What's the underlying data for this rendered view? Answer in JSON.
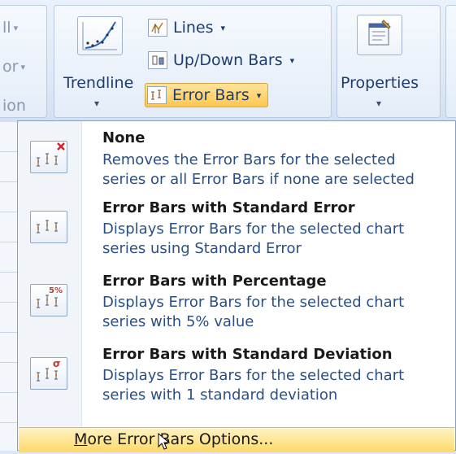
{
  "ribbon": {
    "left_fragments": [
      "ll",
      "or",
      "ion"
    ],
    "trendline": {
      "label": "Trendline"
    },
    "lines": {
      "label": "Lines"
    },
    "updown": {
      "label": "Up/Down Bars"
    },
    "errorbars": {
      "label": "Error Bars"
    },
    "properties": {
      "label": "Properties"
    }
  },
  "menu": {
    "items": [
      {
        "title": "None",
        "desc": [
          "Removes the Error Bars for the selected",
          "series or all Error Bars if none are selected"
        ],
        "icon": "error-bars-none-icon"
      },
      {
        "title": "Error Bars with Standard Error",
        "desc": [
          "Displays Error Bars for the selected chart",
          "series using Standard Error"
        ],
        "icon": "error-bars-standard-error-icon"
      },
      {
        "title": "Error Bars with Percentage",
        "desc": [
          "Displays Error Bars for the selected chart",
          "series with 5% value"
        ],
        "icon": "error-bars-percentage-icon",
        "badge": "5%"
      },
      {
        "title": "Error Bars with Standard Deviation",
        "desc": [
          "Displays Error Bars for the selected chart",
          "series with 1 standard deviation"
        ],
        "icon": "error-bars-standard-deviation-icon",
        "badge": "σ"
      }
    ],
    "more": {
      "accel": "M",
      "rest": "ore Error Bars Options..."
    }
  },
  "colors": {
    "accent_highlight": "#ffd968",
    "link_text": "#2a4f85",
    "remove_x": "#d42020",
    "badge": "#c0392b"
  }
}
